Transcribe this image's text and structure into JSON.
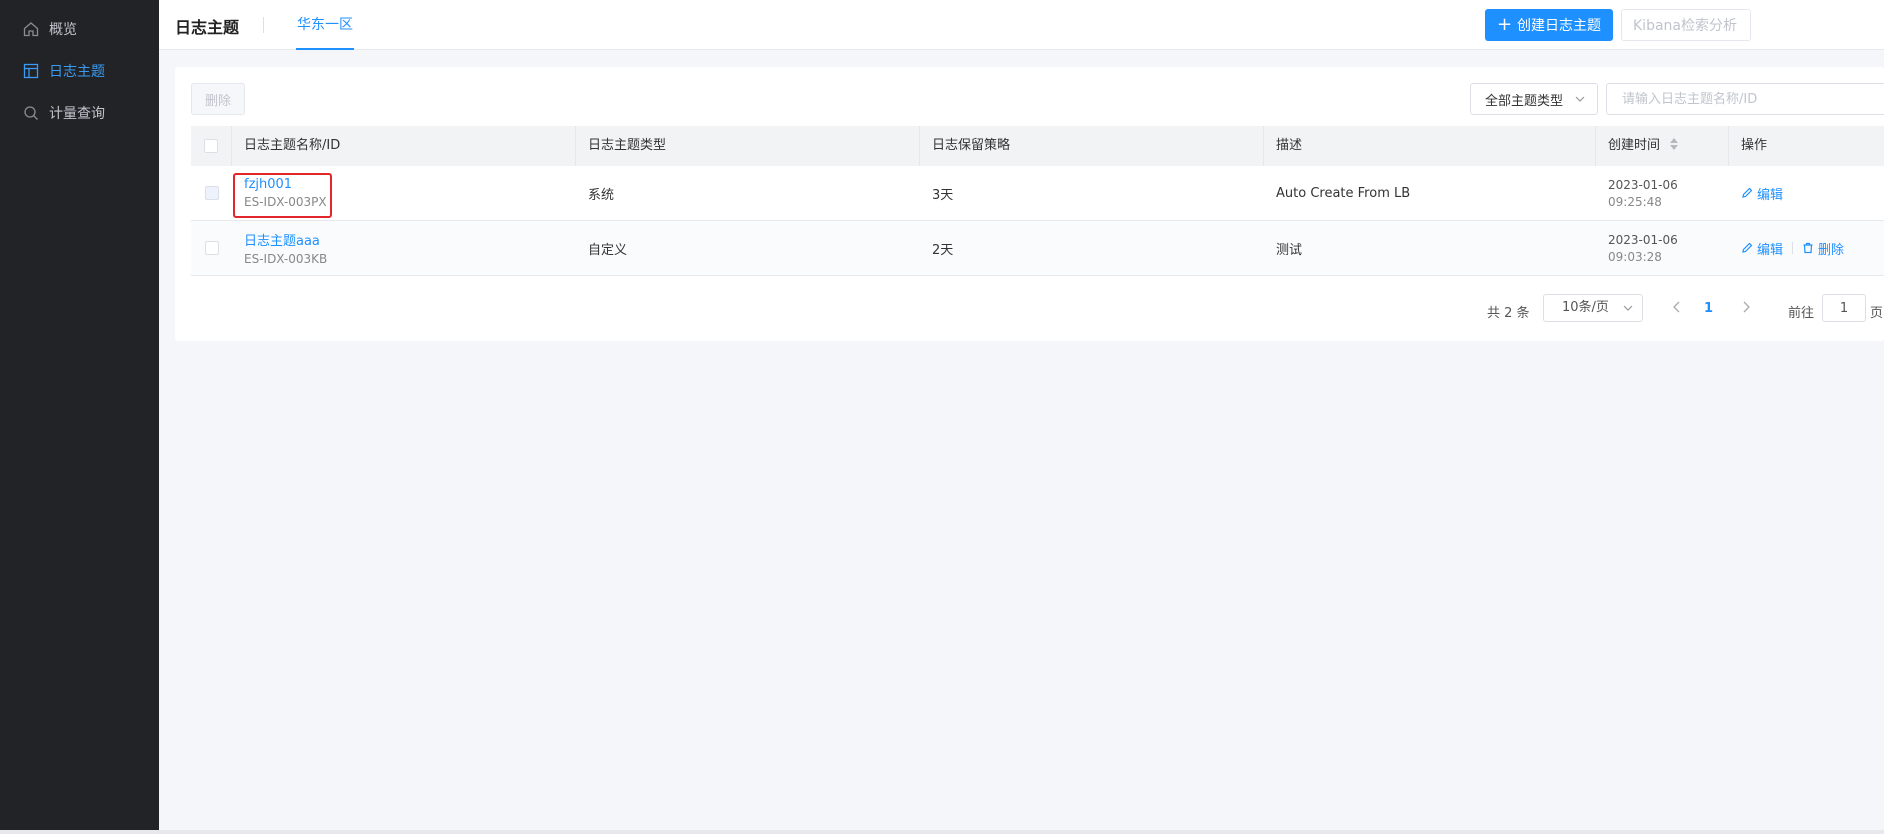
{
  "sidebar": {
    "items": [
      {
        "label": "概览",
        "icon": "home-icon",
        "active": false
      },
      {
        "label": "日志主题",
        "icon": "layout-icon",
        "active": true
      },
      {
        "label": "计量查询",
        "icon": "search-icon",
        "active": false
      }
    ]
  },
  "header": {
    "title": "日志主题",
    "region_tab": "华东一区",
    "create_button": "创建日志主题",
    "kibana_button": "Kibana检索分析"
  },
  "toolbar": {
    "delete_button": "删除",
    "type_filter": "全部主题类型",
    "search_placeholder": "请输入日志主题名称/ID"
  },
  "table": {
    "columns": [
      "日志主题名称/ID",
      "日志主题类型",
      "日志保留策略",
      "描述",
      "创建时间",
      "操作"
    ],
    "rows": [
      {
        "name": "fzjh001",
        "id": "ES-IDX-003PX",
        "type": "系统",
        "retention": "3天",
        "description": "Auto Create From LB",
        "date": "2023-01-06",
        "time": "09:25:48",
        "actions": [
          "编辑"
        ]
      },
      {
        "name": "日志主题aaa",
        "id": "ES-IDX-003KB",
        "type": "自定义",
        "retention": "2天",
        "description": "测试",
        "date": "2023-01-06",
        "time": "09:03:28",
        "actions": [
          "编辑",
          "删除"
        ]
      }
    ]
  },
  "pagination": {
    "total": "共 2 条",
    "page_size": "10条/页",
    "current_page": "1",
    "goto_label": "前往",
    "goto_value": "1",
    "page_suffix": "页"
  },
  "colors": {
    "accent": "#1e90ff",
    "sidebar_bg": "#222327",
    "highlight": "#e3262b"
  }
}
